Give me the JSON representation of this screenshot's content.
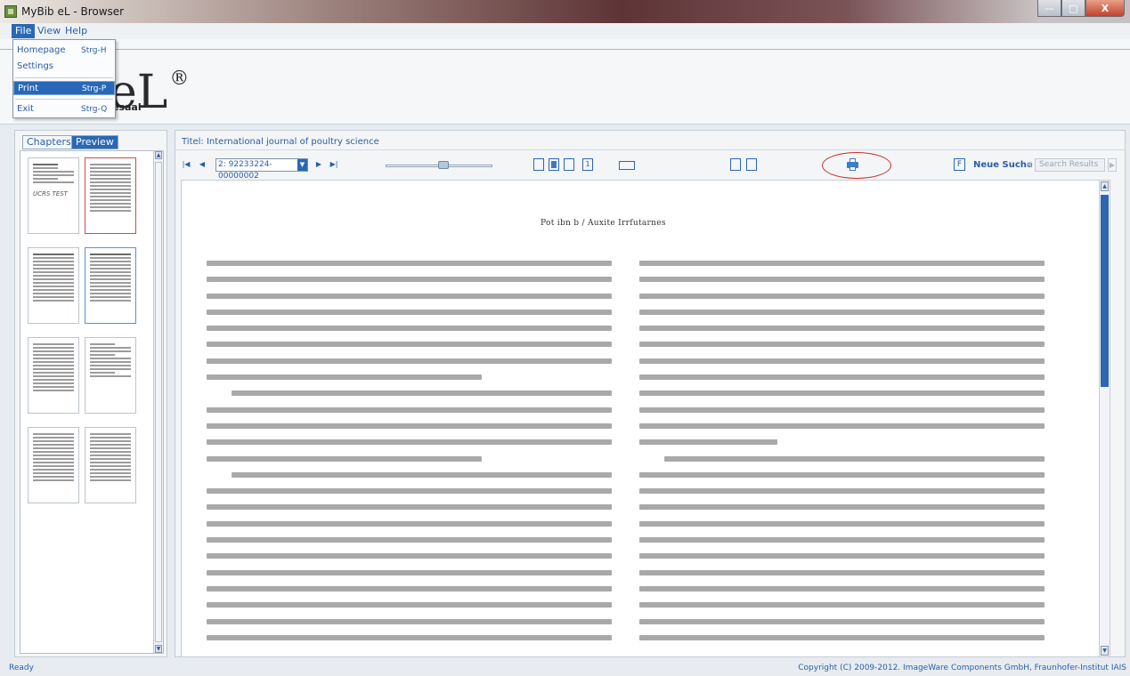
{
  "window": {
    "title": "MyBib eL - Browser",
    "min": "—",
    "max": "□",
    "close": "X"
  },
  "menu": {
    "file": "File",
    "view": "View",
    "help": "Help"
  },
  "file_menu": {
    "homepage": "Homepage",
    "homepage_sc": "Strg-H",
    "settings": "Settings",
    "print": "Print",
    "print_sc": "Strg-P",
    "exit": "Exit",
    "exit_sc": "Strg-Q"
  },
  "header": {
    "logo": "eL",
    "logo_mark": "®",
    "subtitle": "esaal"
  },
  "left_tabs": {
    "chapters": "Chapters",
    "preview": "Preview"
  },
  "thumbnails": {
    "handwritten_note": "UCRS TEST"
  },
  "document": {
    "title": "Titel: International journal of poultry science",
    "page_value": "2: 92233224-00000002",
    "single_page": "1",
    "page_heading": "Pot ibn b / Auxite Irrfutarnes",
    "search_new": "Neue Suche",
    "search_results": "Search Results",
    "find_label": "F"
  },
  "status": {
    "left": "Ready",
    "right": "Copyright (C) 2009-2012. ImageWare Components GmbH, Fraunhofer-Institut IAIS"
  },
  "colors": {
    "accent": "#2968b6",
    "link": "#2a5ea8",
    "highlight_ring": "#c9302c"
  }
}
